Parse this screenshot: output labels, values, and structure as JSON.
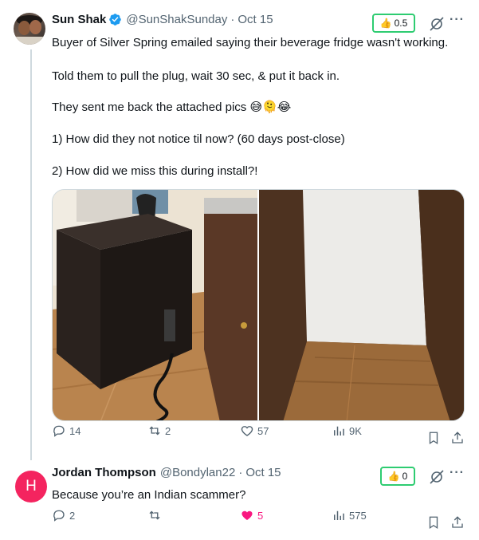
{
  "tweets": [
    {
      "display_name": "Sun Shak",
      "handle": "@SunShakSunday",
      "separator": "·",
      "time": "Oct 15",
      "score": "0.5",
      "more": "···",
      "paragraphs": [
        "Buyer of Silver Spring emailed saying their beverage fridge wasn't working.",
        "Told them to pull the plug, wait 30 sec, & put it back in.",
        "They sent me back the attached pics 😅🫠😂",
        "1) How did they not notice til now? (60 days post-close)",
        "2) How did we miss this during install?!"
      ],
      "actions": {
        "replies": "14",
        "reposts": "2",
        "likes": "57",
        "views": "9K"
      }
    },
    {
      "avatar_letter": "H",
      "display_name": "Jordan Thompson",
      "handle": "@Bondylan22",
      "separator": "·",
      "time": "Oct 15",
      "score": "0",
      "more": "···",
      "text": "Because you’re an Indian scammer?",
      "actions": {
        "replies": "2",
        "reposts": "",
        "likes": "5",
        "views": "575"
      }
    }
  ],
  "colors": {
    "verified": "#1d9bf0",
    "score_border": "#2ecc71",
    "like_active": "#f91880",
    "avatar_h": "#f4245f",
    "secondary_text": "#536471"
  },
  "icons": [
    "verified-badge-icon",
    "thumbs-up-icon",
    "mute-icon",
    "more-icon",
    "reply-icon",
    "repost-icon",
    "like-icon",
    "views-icon",
    "bookmark-icon",
    "share-icon"
  ]
}
